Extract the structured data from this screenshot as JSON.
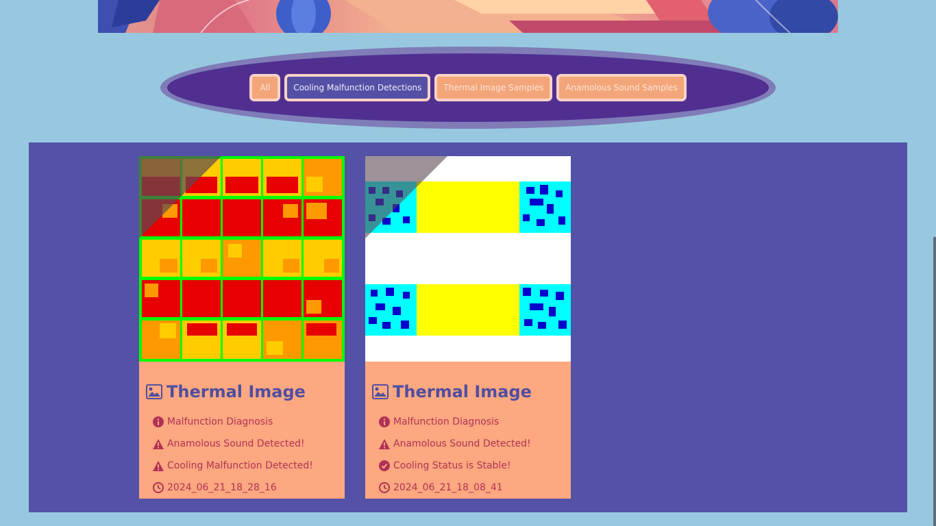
{
  "filters": [
    {
      "label": "All",
      "active": false
    },
    {
      "label": "Cooling Malfunction Detections",
      "active": true
    },
    {
      "label": "Thermal Image Samples",
      "active": false
    },
    {
      "label": "Anamolous Sound Samples",
      "active": false
    }
  ],
  "cards": [
    {
      "title": "Thermal Image",
      "items": [
        {
          "icon": "info-circle-icon",
          "text": "Malfunction Diagnosis"
        },
        {
          "icon": "warning-triangle-icon",
          "text": "Anamolous Sound Detected!"
        },
        {
          "icon": "warning-triangle-icon",
          "text": "Cooling Malfunction Detected!"
        },
        {
          "icon": "clock-icon",
          "text": "2024_06_21_18_28_16"
        }
      ]
    },
    {
      "title": "Thermal Image",
      "items": [
        {
          "icon": "info-circle-icon",
          "text": "Malfunction Diagnosis"
        },
        {
          "icon": "warning-triangle-icon",
          "text": "Anamolous Sound Detected!"
        },
        {
          "icon": "check-circle-icon",
          "text": "Cooling Status is Stable!"
        },
        {
          "icon": "clock-icon",
          "text": "2024_06_21_18_08_41"
        }
      ]
    }
  ],
  "colors": {
    "page_bg": "#98c8df",
    "panel_bg": "#5452a6",
    "card_bg": "#fda880",
    "accent_text": "#b03155",
    "title_text": "#514ea0"
  }
}
